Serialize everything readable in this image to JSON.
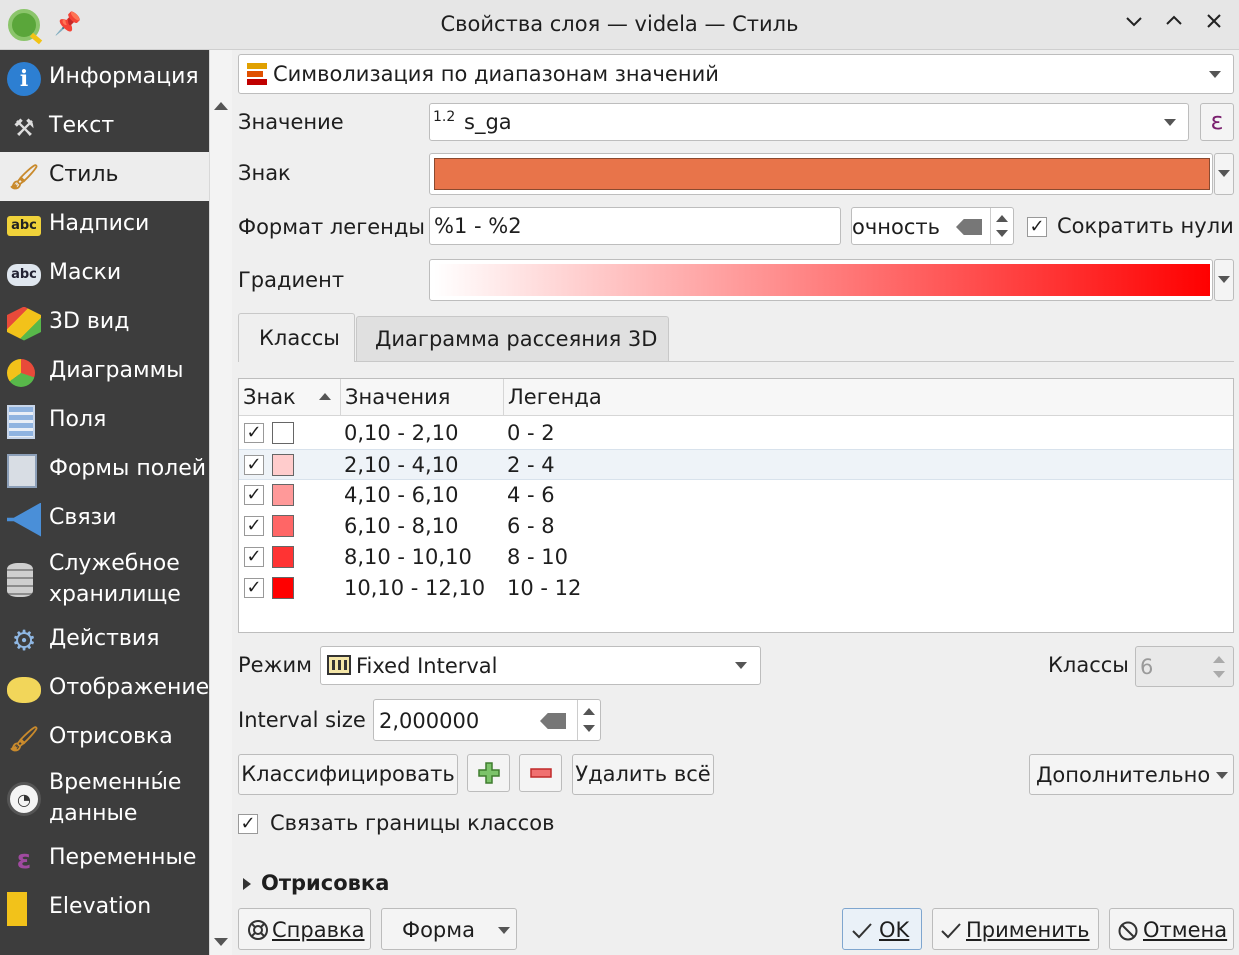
{
  "window": {
    "title": "Свойства слоя — videla — Стиль",
    "controls": [
      "minimize",
      "maximize",
      "close"
    ]
  },
  "sidebar": {
    "search_placeholder": "",
    "items": [
      {
        "label": "Информация",
        "icon": "info-icon"
      },
      {
        "label": "Текст",
        "icon": "text-tools-icon"
      },
      {
        "label": "Стиль",
        "icon": "paintbrush-icon",
        "active": true
      },
      {
        "label": "Надписи",
        "icon": "labels-abc-icon"
      },
      {
        "label": "Маски",
        "icon": "masks-abc-icon"
      },
      {
        "label": "3D вид",
        "icon": "cube-3d-icon"
      },
      {
        "label": "Диаграммы",
        "icon": "diagrams-icon"
      },
      {
        "label": "Поля",
        "icon": "fields-icon"
      },
      {
        "label": "Формы полей",
        "icon": "forms-icon"
      },
      {
        "label": "Связи",
        "icon": "joins-icon"
      },
      {
        "label": "Служебное хранилище",
        "icon": "storage-icon"
      },
      {
        "label": "Действия",
        "icon": "actions-gear-icon"
      },
      {
        "label": "Отображение",
        "icon": "display-bubble-icon"
      },
      {
        "label": "Отрисовка",
        "icon": "rendering-brush-icon"
      },
      {
        "label": "Временны́е данные",
        "icon": "clock-icon"
      },
      {
        "label": "Переменные",
        "icon": "epsilon-icon"
      },
      {
        "label": "Elevation",
        "icon": "elevation-icon"
      }
    ]
  },
  "renderer": {
    "selected": "Символизация по диапазонам значений"
  },
  "value": {
    "label": "Значение",
    "type_badge": "1.2",
    "field": "s_ga",
    "expression_button": "ε"
  },
  "symbol": {
    "label": "Знак",
    "color": "#e8744a"
  },
  "legend_format": {
    "label": "Формат легенды",
    "value": "%1 - %2",
    "precision_text": "очность",
    "trim_zeros_label": "Сократить нули",
    "trim_zeros_checked": true
  },
  "gradient": {
    "label": "Градиент",
    "from": "#ffffff",
    "to": "#ff0000"
  },
  "tabs": [
    {
      "label": "Классы",
      "active": true
    },
    {
      "label": "Диаграмма рассеяния 3D",
      "active": false
    }
  ],
  "table": {
    "headers": [
      "Знак",
      "Значения",
      "Легенда"
    ],
    "rows": [
      {
        "checked": true,
        "color": "#ffffff",
        "values": "0,10 - 2,10",
        "legend": "0 - 2"
      },
      {
        "checked": true,
        "color": "#ffcccc",
        "values": "2,10 - 4,10",
        "legend": "2 - 4",
        "selected": true
      },
      {
        "checked": true,
        "color": "#ff9999",
        "values": "4,10 - 6,10",
        "legend": "4 - 6"
      },
      {
        "checked": true,
        "color": "#ff6666",
        "values": "6,10 - 8,10",
        "legend": "6 - 8"
      },
      {
        "checked": true,
        "color": "#ff3333",
        "values": "8,10 - 10,10",
        "legend": "8 - 10"
      },
      {
        "checked": true,
        "color": "#ff0000",
        "values": "10,10 - 12,10",
        "legend": "10 - 12"
      }
    ]
  },
  "mode": {
    "label": "Режим",
    "value": "Fixed Interval",
    "classes_label": "Классы",
    "classes_value": "6"
  },
  "interval": {
    "label": "Interval size",
    "value": "2,000000"
  },
  "actions": {
    "classify": "Классифицировать",
    "delete_all": "Удалить всё",
    "advanced": "Дополнительно"
  },
  "link_bounds": {
    "label": "Связать границы классов",
    "checked": true
  },
  "rendering_section": "Отрисовка",
  "footer": {
    "help": "Справка",
    "style": "Форма",
    "ok": "OK",
    "apply": "Применить",
    "cancel": "Отмена"
  }
}
